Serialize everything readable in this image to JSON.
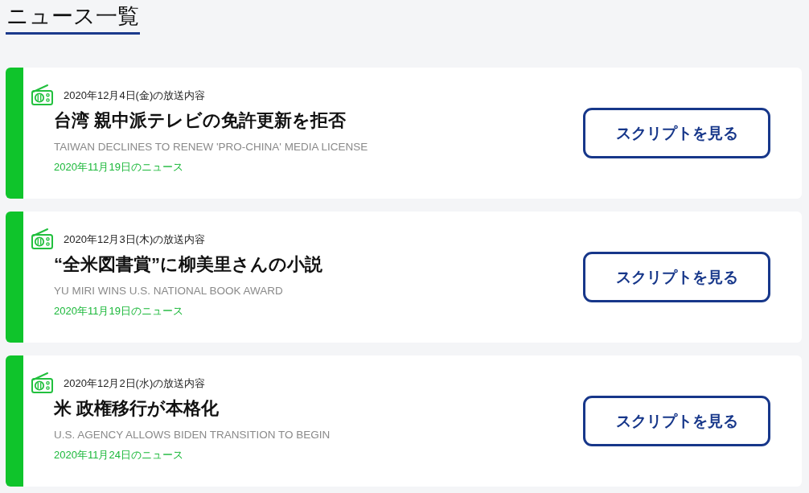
{
  "page": {
    "title": "ニュース一覧"
  },
  "news_items": [
    {
      "broadcast_date": "2020年12月4日(金)の放送内容",
      "title": "台湾 親中派テレビの免許更新を拒否",
      "english_title": "TAIWAN DECLINES TO RENEW 'PRO-CHINA' MEDIA LICENSE",
      "news_date": "2020年11月19日のニュース",
      "button_label": "スクリプトを見る"
    },
    {
      "broadcast_date": "2020年12月3日(木)の放送内容",
      "title": "“全米図書賞”に柳美里さんの小説",
      "english_title": "YU MIRI WINS U.S. NATIONAL BOOK AWARD",
      "news_date": "2020年11月19日のニュース",
      "button_label": "スクリプトを見る"
    },
    {
      "broadcast_date": "2020年12月2日(水)の放送内容",
      "title": "米 政権移行が本格化",
      "english_title": "U.S. AGENCY ALLOWS BIDEN TRANSITION TO BEGIN",
      "news_date": "2020年11月24日のニュース",
      "button_label": "スクリプトを見る"
    }
  ]
}
